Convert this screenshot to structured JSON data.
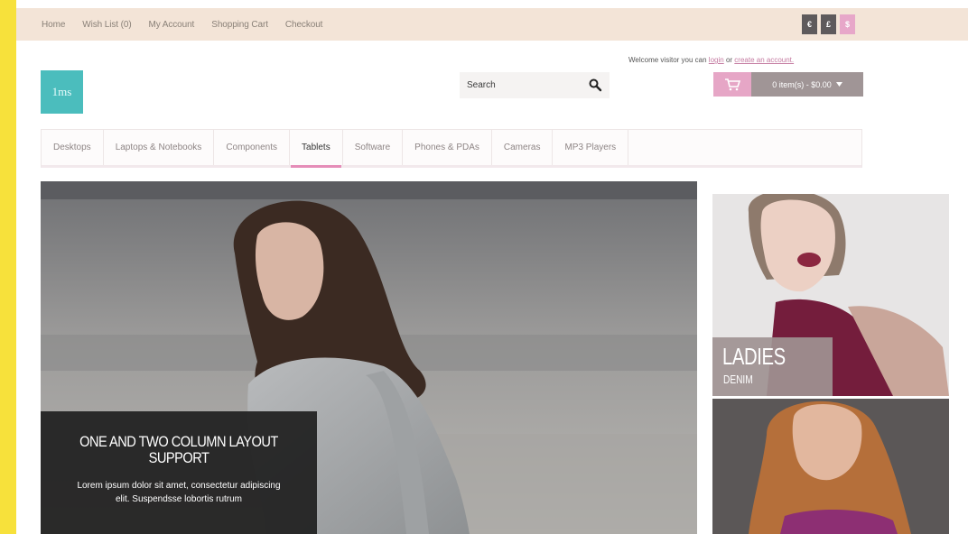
{
  "topbar": {
    "links": [
      "Home",
      "Wish List (0)",
      "My Account",
      "Shopping Cart",
      "Checkout"
    ],
    "buttons": [
      "€",
      "£",
      "$"
    ]
  },
  "header": {
    "logo_text": "1ms",
    "search_placeholder": "Search",
    "welcome_prefix": "Welcome visitor you can",
    "login_label": "login",
    "welcome_or": "or",
    "create_account_label": "create an account.",
    "cart_label": "0 item(s) - $0.00"
  },
  "nav": {
    "items": [
      "Desktops",
      "Laptops & Notebooks",
      "Components",
      "Tablets",
      "Software",
      "Phones & PDAs",
      "Cameras",
      "MP3 Players"
    ],
    "active_index": 3
  },
  "slideshow": {
    "caption_title": "ONE AND TWO COLUMN LAYOUT SUPPORT",
    "caption_text": "Lorem ipsum dolor sit amet, consectetur adipiscing elit. Suspendsse lobortis rutrum"
  },
  "banners": {
    "ladies_title": "LADIES",
    "ladies_subtitle": "DENIM"
  },
  "colors": {
    "accent_pink": "#e58db8",
    "teal_logo": "#4bbdbd",
    "topbar_bg": "#f3e4d7"
  }
}
